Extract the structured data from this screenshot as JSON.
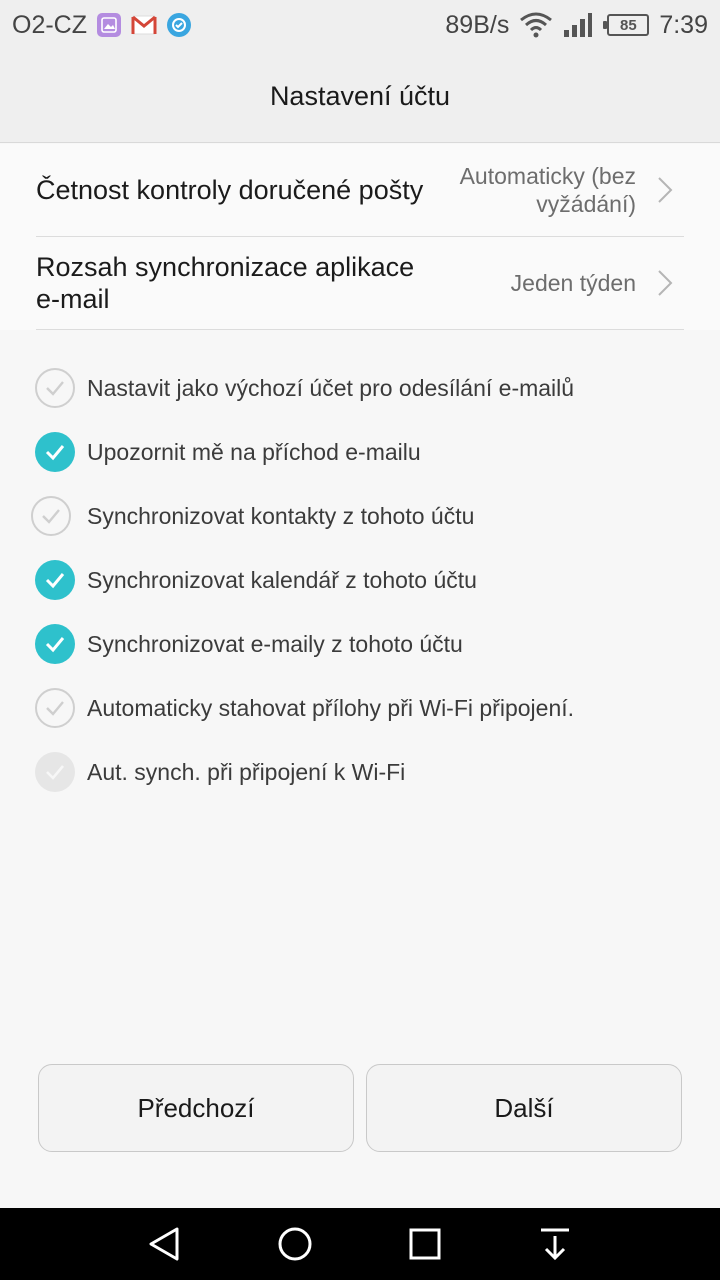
{
  "status_bar": {
    "carrier": "O2-CZ",
    "net_speed": "89B/s",
    "battery": "85",
    "time": "7:39",
    "icons": [
      "gallery-icon",
      "gmail-icon",
      "app-icon",
      "wifi-icon",
      "signal-icon",
      "battery-icon"
    ]
  },
  "header": {
    "title": "Nastavení účtu"
  },
  "settings": [
    {
      "label": "Četnost kontroly doručené pošty",
      "value": "Automaticky (bez vyžádání)"
    },
    {
      "label": "Rozsah synchronizace aplikace e-mail",
      "value": "Jeden týden"
    }
  ],
  "options": [
    {
      "label": "Nastavit jako výchozí účet pro odesílání e-mailů",
      "checked": false,
      "enabled": true
    },
    {
      "label": "Upozornit mě na příchod e-mailu",
      "checked": true,
      "enabled": true
    },
    {
      "label": "Synchronizovat kontakty z tohoto účtu",
      "checked": false,
      "enabled": true
    },
    {
      "label": "Synchronizovat kalendář z tohoto účtu",
      "checked": true,
      "enabled": true
    },
    {
      "label": "Synchronizovat e-maily z tohoto účtu",
      "checked": true,
      "enabled": true
    },
    {
      "label": "Automaticky stahovat přílohy při Wi-Fi připojení.",
      "checked": false,
      "enabled": true
    },
    {
      "label": "Aut. synch. při připojení k Wi-Fi",
      "checked": false,
      "enabled": false
    }
  ],
  "buttons": {
    "previous": "Předchozí",
    "next": "Další"
  },
  "colors": {
    "accent": "#2ec1cc",
    "background": "#f7f7f7",
    "header_bg": "#efefef",
    "nav_bg": "#000000"
  }
}
